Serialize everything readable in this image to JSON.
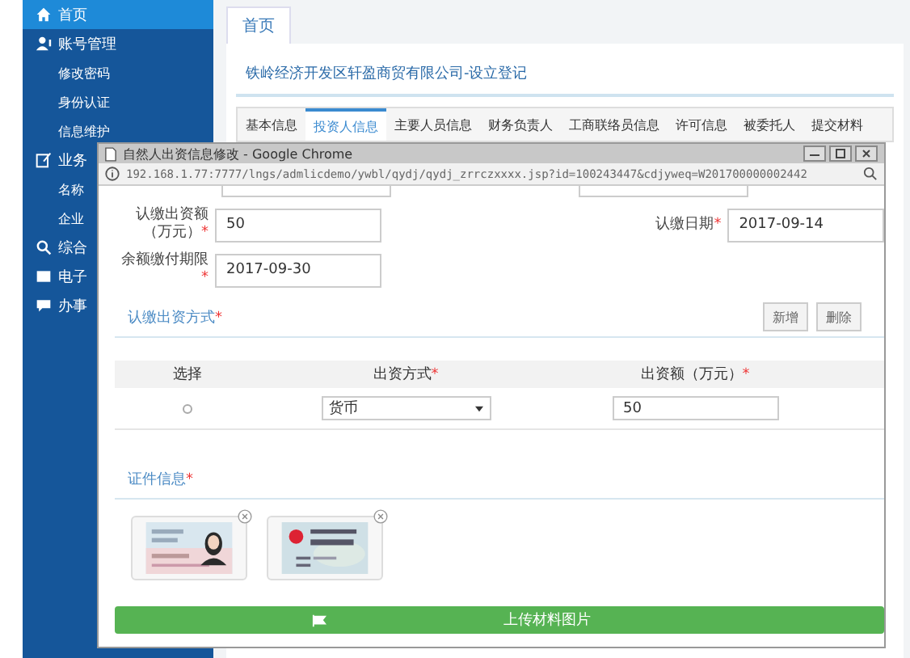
{
  "sidebar": {
    "items": [
      {
        "label": "首页",
        "selected": true
      },
      {
        "label": "账号管理",
        "selected": false,
        "children": [
          {
            "label": "修改密码"
          },
          {
            "label": "身份认证"
          },
          {
            "label": "信息维护"
          }
        ]
      },
      {
        "label": "业务",
        "selected": false,
        "children": [
          {
            "label": "名称"
          },
          {
            "label": "企业"
          }
        ]
      },
      {
        "label": "综合",
        "selected": false
      },
      {
        "label": "电子",
        "selected": false
      },
      {
        "label": "办事",
        "selected": false
      }
    ]
  },
  "page_tabs": [
    {
      "label": "首页",
      "selected": true
    }
  ],
  "company_title": "铁岭经济开发区轩盈商贸有限公司-设立登记",
  "tabs": [
    {
      "label": "基本信息",
      "selected": false
    },
    {
      "label": "投资人信息",
      "selected": true
    },
    {
      "label": "主要人员信息",
      "selected": false
    },
    {
      "label": "财务负责人",
      "selected": false
    },
    {
      "label": "工商联络员信息",
      "selected": false
    },
    {
      "label": "许可信息",
      "selected": false
    },
    {
      "label": "被委托人",
      "selected": false
    },
    {
      "label": "提交材料",
      "selected": false
    }
  ],
  "popup": {
    "title": "自然人出资信息修改 - Google Chrome",
    "url": "192.168.1.77:7777/lngs/admlicdemo/ywbl/qydj/qydj_zrrczxxxx.jsp?id=100243447&cdjyweq=W201700000002442",
    "fields": [
      {
        "label": "认缴出资额（万元）",
        "mark": "*",
        "value": "50"
      },
      {
        "label": "认缴日期",
        "mark": "*",
        "value": "2017-09-14"
      },
      {
        "label": "余额缴付期限",
        "mark": "*",
        "value": "2017-09-30"
      }
    ],
    "contribution": {
      "title": "认缴出资方式",
      "mark": "*",
      "buttons": [
        "新增",
        "删除"
      ],
      "columns": [
        {
          "label": "选择"
        },
        {
          "label": "出资方式",
          "mark": "*"
        },
        {
          "label": "出资额（万元）",
          "mark": "*"
        }
      ],
      "rows": [
        {
          "selected": false,
          "method": "货币",
          "amount": "50"
        }
      ]
    },
    "documents": {
      "title": "证件信息",
      "mark": "*"
    },
    "upload_button": "上传材料图片"
  }
}
